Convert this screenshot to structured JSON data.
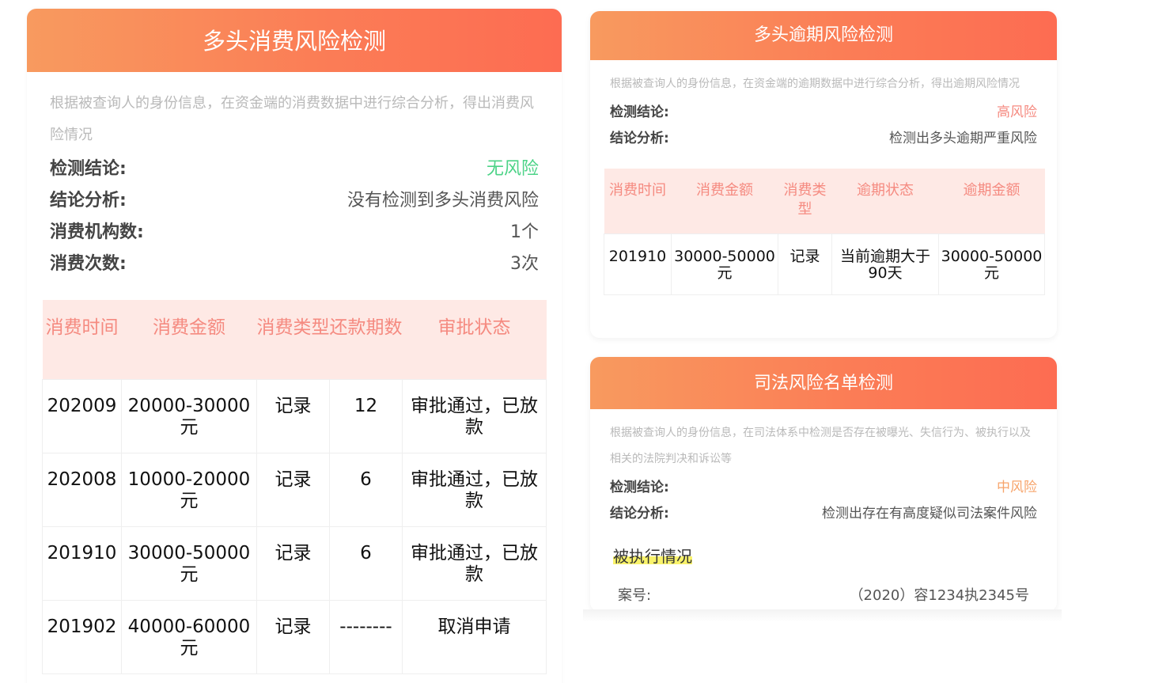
{
  "consumption": {
    "title": "多头消费风险检测",
    "description": "根据被查询人的身份信息，在资金端的消费数据中进行综合分析，得出消费风险情况",
    "fields": [
      {
        "label": "检测结论:",
        "value": "无风险",
        "color": "#4cd387"
      },
      {
        "label": "结论分析:",
        "value": "没有检测到多头消费风险",
        "color": "#555555"
      },
      {
        "label": "消费机构数:",
        "value": "1个",
        "color": "#555555"
      },
      {
        "label": "消费次数:",
        "value": "3次",
        "color": "#555555"
      }
    ],
    "table": {
      "headers": [
        "消费时间",
        "消费金额",
        "消费类型",
        "还款期数",
        "审批状态"
      ],
      "rows": [
        [
          "202009",
          "20000-30000元",
          "记录",
          "12",
          "审批通过，已放款"
        ],
        [
          "202008",
          "10000-20000元",
          "记录",
          "6",
          "审批通过，已放款"
        ],
        [
          "201910",
          "30000-50000元",
          "记录",
          "6",
          "审批通过，已放款"
        ],
        [
          "201902",
          "40000-60000元",
          "记录",
          "--------",
          "取消申请"
        ]
      ]
    }
  },
  "overdue": {
    "title": "多头逾期风险检测",
    "description": "根据被查询人的身份信息，在资金端的逾期数据中进行综合分析，得出逾期风险情况",
    "fields": [
      {
        "label": "检测结论:",
        "value": "高风险",
        "color": "#f58a80"
      },
      {
        "label": "结论分析:",
        "value": "检测出多头逾期严重风险",
        "color": "#555555"
      }
    ],
    "table": {
      "headers": [
        "消费时间",
        "消费金额",
        "消费类型",
        "逾期状态",
        "逾期金额"
      ],
      "rows": [
        [
          "201910",
          "30000-50000元",
          "记录",
          "当前逾期大于90天",
          "30000-50000元"
        ]
      ]
    }
  },
  "judicial": {
    "title": "司法风险名单检测",
    "description": "根据被查询人的身份信息，在司法体系中检测是否存在被曝光、失信行为、被执行以及相关的法院判决和诉讼等",
    "fields": [
      {
        "label": "检测结论:",
        "value": "中风险",
        "color": "#f7a46b"
      },
      {
        "label": "结论分析:",
        "value": "检测出存在有高度疑似司法案件风险",
        "color": "#555555"
      }
    ],
    "section_title": "被执行情况",
    "case": {
      "label": "案号:",
      "value": "（2020）容1234执2345号"
    }
  }
}
